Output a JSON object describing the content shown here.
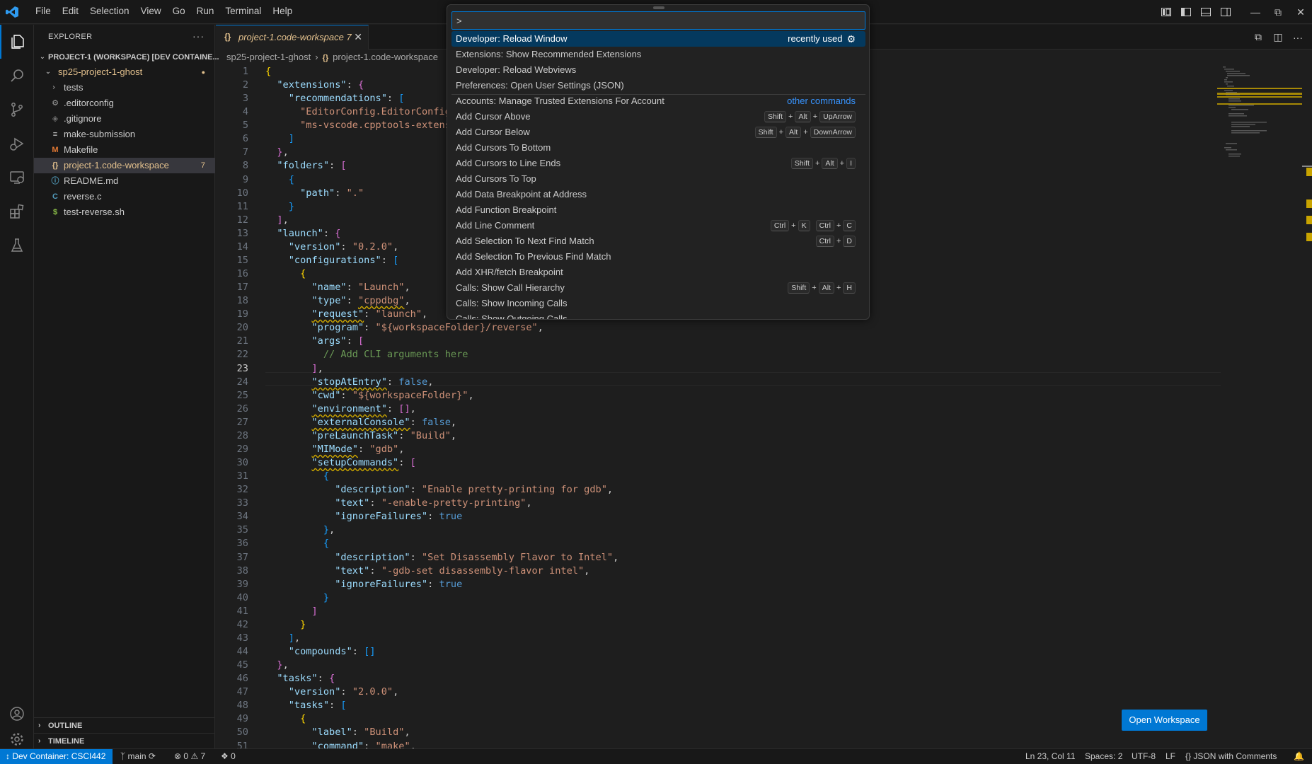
{
  "menu": [
    "File",
    "Edit",
    "Selection",
    "View",
    "Go",
    "Run",
    "Terminal",
    "Help"
  ],
  "explorer": {
    "title": "EXPLORER",
    "workspace": "PROJECT-1 (WORKSPACE) [DEV CONTAINE...",
    "root_folder": "sp25-project-1-ghost",
    "files": [
      {
        "name": "tests",
        "icon": "chevron-right-icon"
      },
      {
        "name": ".editorconfig",
        "icon": "gear-icon"
      },
      {
        "name": ".gitignore",
        "icon": "git-icon"
      },
      {
        "name": "make-submission",
        "icon": "list-icon"
      },
      {
        "name": "Makefile",
        "icon": "makefile-icon"
      },
      {
        "name": "project-1.code-workspace",
        "icon": "braces-icon",
        "badge": "7"
      },
      {
        "name": "README.md",
        "icon": "info-icon"
      },
      {
        "name": "reverse.c",
        "icon": "c-icon"
      },
      {
        "name": "test-reverse.sh",
        "icon": "dollar-icon"
      }
    ],
    "outline": "OUTLINE",
    "timeline": "TIMELINE"
  },
  "tab": {
    "label": "project-1.code-workspace",
    "badge": "7"
  },
  "breadcrumb": {
    "folder": "sp25-project-1-ghost",
    "file": "project-1.code-workspace"
  },
  "palette": {
    "input": ">",
    "recently_used": "recently used",
    "other_commands": "other commands",
    "items": [
      "Developer: Reload Window",
      "Extensions: Show Recommended Extensions",
      "Developer: Reload Webviews",
      "Preferences: Open User Settings (JSON)",
      "Accounts: Manage Trusted Extensions For Account",
      "Add Cursor Above",
      "Add Cursor Below",
      "Add Cursors To Bottom",
      "Add Cursors to Line Ends",
      "Add Cursors To Top",
      "Add Data Breakpoint at Address",
      "Add Function Breakpoint",
      "Add Line Comment",
      "Add Selection To Next Find Match",
      "Add Selection To Previous Find Match",
      "Add XHR/fetch Breakpoint",
      "Calls: Show Call Hierarchy",
      "Calls: Show Incoming Calls",
      "Calls: Show Outgoing Calls"
    ],
    "keys": {
      "shift": "Shift",
      "alt": "Alt",
      "ctrl": "Ctrl",
      "plus": "+",
      "up": "UpArrow",
      "down": "DownArrow",
      "i": "I",
      "k": "K",
      "c": "C",
      "d": "D",
      "h": "H"
    }
  },
  "open_workspace": "Open Workspace",
  "status": {
    "remote": "Dev Container: CSCI442",
    "branch": "main",
    "errors": "0",
    "warnings": "7",
    "ports": "0",
    "position": "Ln 23, Col 11",
    "spaces": "Spaces: 2",
    "encoding": "UTF-8",
    "eol": "LF",
    "language": "JSON with Comments"
  },
  "colors": {
    "accent": "#0078d4",
    "modified": "#e2c08d",
    "selection": "#04395e"
  }
}
